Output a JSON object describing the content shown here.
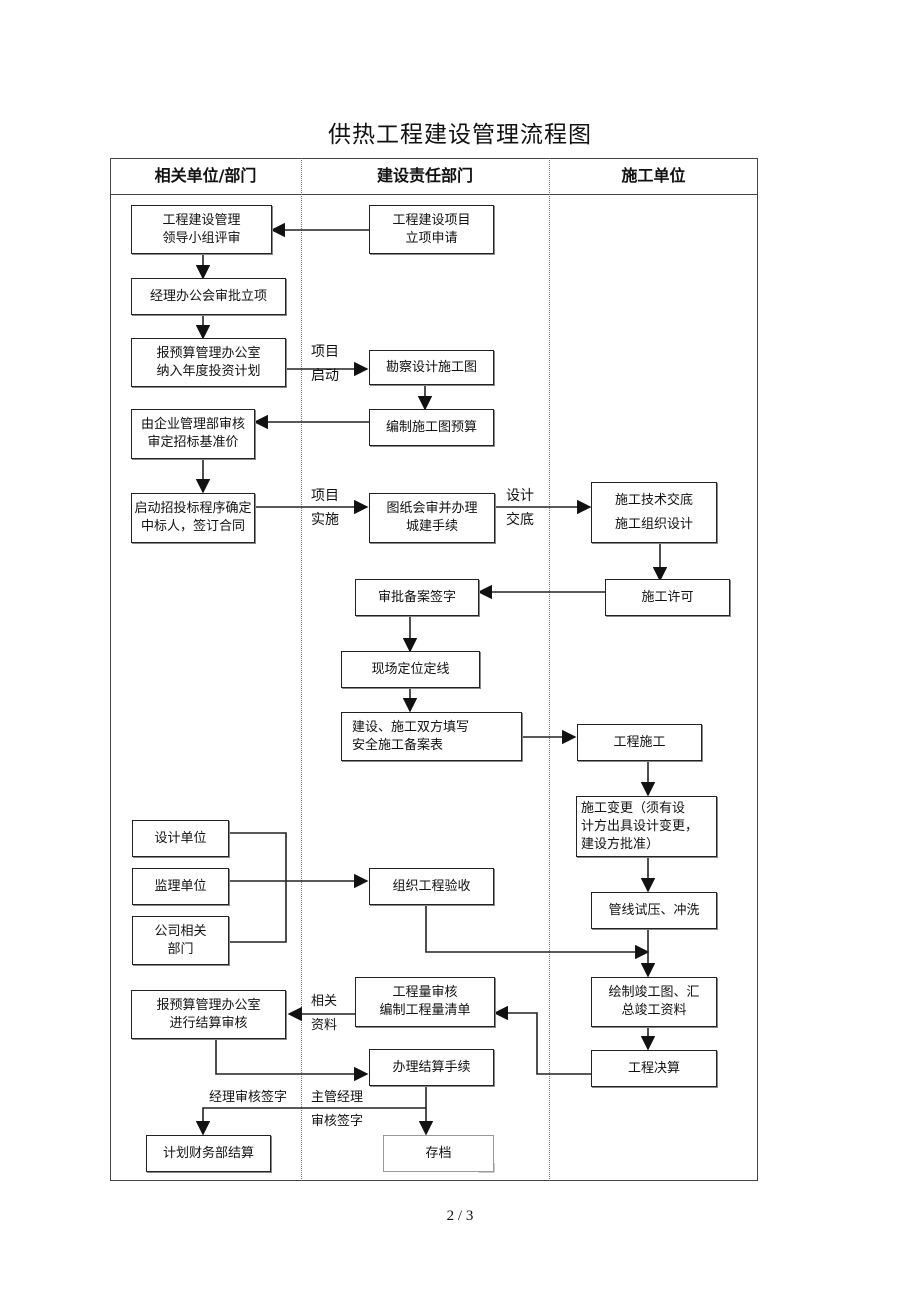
{
  "title": "供热工程建设管理流程图",
  "lanes": [
    {
      "label": "相关单位/部门"
    },
    {
      "label": "建设责任部门"
    },
    {
      "label": "施工单位"
    }
  ],
  "nodes": {
    "leader_review": "工程建设管理\n领导小组评审",
    "project_apply": "工程建设项目\n立项申请",
    "manager_approve": "经理办公会审批立项",
    "budget_plan": "报预算管理办公室\n纳入年度投资计划",
    "survey_design": "勘察设计施工图",
    "mgmt_review": "由企业管理部审核\n审定招标基准价",
    "drawing_budget": "编制施工图预算",
    "bidding": "启动招投标程序确定\n中标人，签订合同",
    "drawing_review": "图纸会审并办理\n城建手续",
    "tech_brief": "施工技术交底\n施工组织设计",
    "approve_sign": "审批备案签字",
    "permit": "施工许可",
    "site_layout": "现场定位定线",
    "safety_form": "建设、施工双方填写\n安全施工备案表",
    "construction": "工程施工",
    "change": "施工变更（须有设\n计方出具设计变更，\n建设方批准）",
    "design_unit": "设计单位",
    "supervision_unit": "监理单位",
    "company_depts": "公司相关\n部门",
    "acceptance": "组织工程验收",
    "pressure_test": "管线试压、冲洗",
    "quantity_review": "工程量审核\n编制工程量清单",
    "asbuilt": "绘制竣工图、汇\n总竣工资料",
    "settlement_review": "报预算管理办公室\n进行结算审核",
    "final_accounts": "工程决算",
    "settlement_proc": "办理结算手续",
    "finance_settle": "计划财务部结算",
    "archive": "存档"
  },
  "edge_labels": {
    "project_start": "项目\n启动",
    "project_impl": "项目\n实施",
    "design_brief": "设计\n交底",
    "related_docs": "相关\n资料",
    "manager_sign": "经理审核签字",
    "director_sign": "主管经理\n审核签字"
  },
  "page_number": "2 / 3"
}
